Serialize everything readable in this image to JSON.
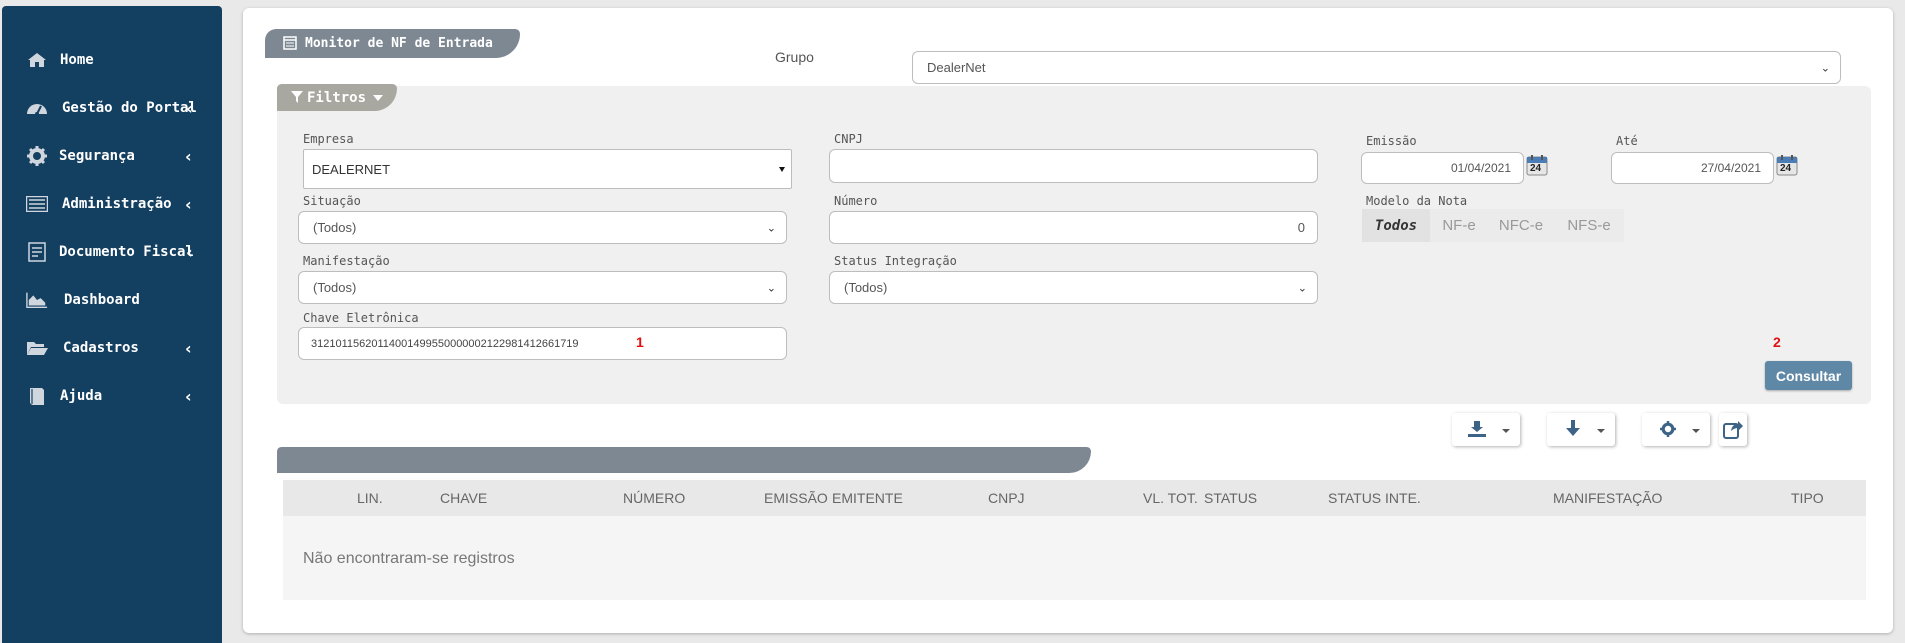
{
  "sidebar": {
    "items": [
      {
        "label": "Home",
        "icon": "home-icon",
        "chevron": ""
      },
      {
        "label": "Gestão do Portal",
        "icon": "dashboard-gauge-icon",
        "chevron": "‹"
      },
      {
        "label": "Segurança",
        "icon": "gear-icon",
        "chevron": "‹"
      },
      {
        "label": "Administração",
        "icon": "list-icon",
        "chevron": "‹"
      },
      {
        "label": "Documento Fiscal",
        "icon": "document-icon",
        "chevron": "‹"
      },
      {
        "label": "Dashboard",
        "icon": "area-chart-icon",
        "chevron": ""
      },
      {
        "label": "Cadastros",
        "icon": "folder-open-icon",
        "chevron": "‹"
      },
      {
        "label": "Ajuda",
        "icon": "book-icon",
        "chevron": "‹"
      }
    ]
  },
  "page": {
    "title": "Monitor de NF de Entrada",
    "grupo_label": "Grupo",
    "grupo_value": "DealerNet"
  },
  "filtros": {
    "tab_label": "Filtros",
    "empresa_label": "Empresa",
    "empresa_value": "DEALERNET",
    "cnpj_label": "CNPJ",
    "cnpj_value": "",
    "emissao_label": "Emissão",
    "emissao_value": "01/04/2021",
    "ate_label": "Até",
    "ate_value": "27/04/2021",
    "calendar_day": "24",
    "situacao_label": "Situação",
    "situacao_value": "(Todos)",
    "numero_label": "Número",
    "numero_value": "0",
    "modelo_label": "Modelo da Nota",
    "modelo_options": [
      "Todos",
      "NF-e",
      "NFC-e",
      "NFS-e"
    ],
    "manifestacao_label": "Manifestação",
    "manifestacao_value": "(Todos)",
    "status_integracao_label": "Status Integração",
    "status_integracao_value": "(Todos)",
    "chave_label": "Chave Eletrônica",
    "chave_value": "31210115620114001499550000002122981412661719",
    "marker1": "1",
    "marker2": "2",
    "consultar_label": "Consultar"
  },
  "grid": {
    "columns": [
      "LIN.",
      "CHAVE",
      "NÚMERO",
      "EMISSÃO",
      "EMITENTE",
      "CNPJ",
      "VL. TOT.",
      "STATUS",
      "STATUS INTE.",
      "MANIFESTAÇÃO",
      "TIPO"
    ],
    "empty_message": "Não encontraram-se registros"
  },
  "colors": {
    "sidebar_bg": "#133f61",
    "accent_button": "#5f87a6",
    "tab_gray": "#7e8893",
    "filtros_tab": "#a8a8a0",
    "marker_red": "#e01010"
  }
}
